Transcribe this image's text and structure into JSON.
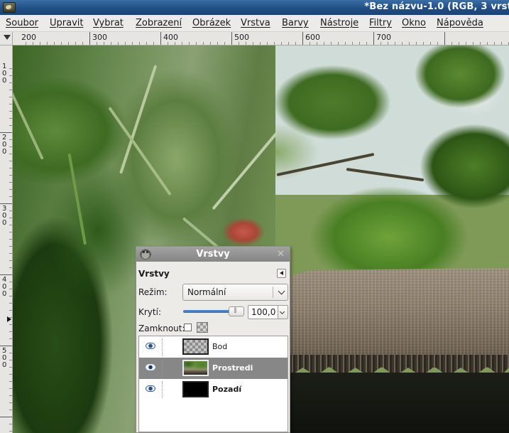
{
  "window": {
    "title": "*Bez názvu-1.0 (RGB, 3 vrst"
  },
  "menu": [
    "Soubor",
    "Upravit",
    "Vybrat",
    "Zobrazení",
    "Obrázek",
    "Vrstva",
    "Barvy",
    "Nástroje",
    "Filtry",
    "Okno",
    "Nápověda"
  ],
  "ruler": {
    "horizontal": [
      "200",
      "300",
      "400",
      "500",
      "600",
      "700"
    ],
    "vertical": [
      "100",
      "200",
      "300",
      "400",
      "500"
    ]
  },
  "layers_dock": {
    "title": "Vrstvy",
    "panel_title": "Vrstvy",
    "mode_label": "Režim:",
    "mode_value": "Normální",
    "opacity_label": "Krytí:",
    "opacity_value": "100,0",
    "opacity_fraction": 1.0,
    "lock_label": "Zamknout:",
    "layers": [
      {
        "name": "Bod",
        "thumbnail": "transparent",
        "visible": true,
        "selected": false
      },
      {
        "name": "Prostredi",
        "thumbnail": "photo",
        "visible": true,
        "selected": true
      },
      {
        "name": "Pozadí",
        "thumbnail": "black",
        "visible": true,
        "selected": false
      }
    ]
  },
  "icons": {
    "app": "gimp-wilber-icon",
    "dock_close": "close-icon",
    "eye": "eye-icon",
    "lock_alpha": "checkerboard-icon"
  },
  "colors": {
    "titlebar": "#214e86",
    "dock_titlebar": "#858585",
    "selected_row": "#878787",
    "slider_fill": "#2f6fb9"
  }
}
